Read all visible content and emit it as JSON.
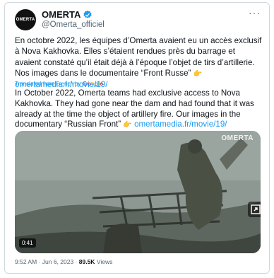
{
  "author": {
    "avatar_text": "OMERTA",
    "display_name": "OMERTA",
    "handle": "@Omerta_officiel",
    "verified_color": "#1d9bf0"
  },
  "tweet": {
    "text_fr": "En octobre 2022, les équipes d’Omerta avaient eu un accès exclusif à Nova Kakhovka. Elles s’étaient rendues près du barrage et avaient constaté qu’il était déjà à l’époque l’objet de tirs d’artillerie. Nos images dans le documentaire “Front Russe”",
    "link_fr": "omertamedia.fr/movie/19/",
    "translated_label": "Translated from French by",
    "translator": "Google",
    "text_en": "In October 2022, Omerta teams had exclusive access to Nova Kakhovka. They had gone near the dam and had found that it was already at the time the object of artillery fire. Our images in the documentary “Russian Front”",
    "link_en": "omertamedia.fr/movie/19/",
    "pointing_emoji": "👉"
  },
  "media": {
    "watermark": "OMERTA",
    "duration": "0:41"
  },
  "meta": {
    "time": "9:52 AM",
    "separator": " · ",
    "date": "Jun 6, 2023",
    "views_count": "89.5K",
    "views_label": "Views"
  },
  "icons": {
    "more": "more-icon",
    "verified": "verified-badge-icon",
    "expand": "expand-icon"
  }
}
